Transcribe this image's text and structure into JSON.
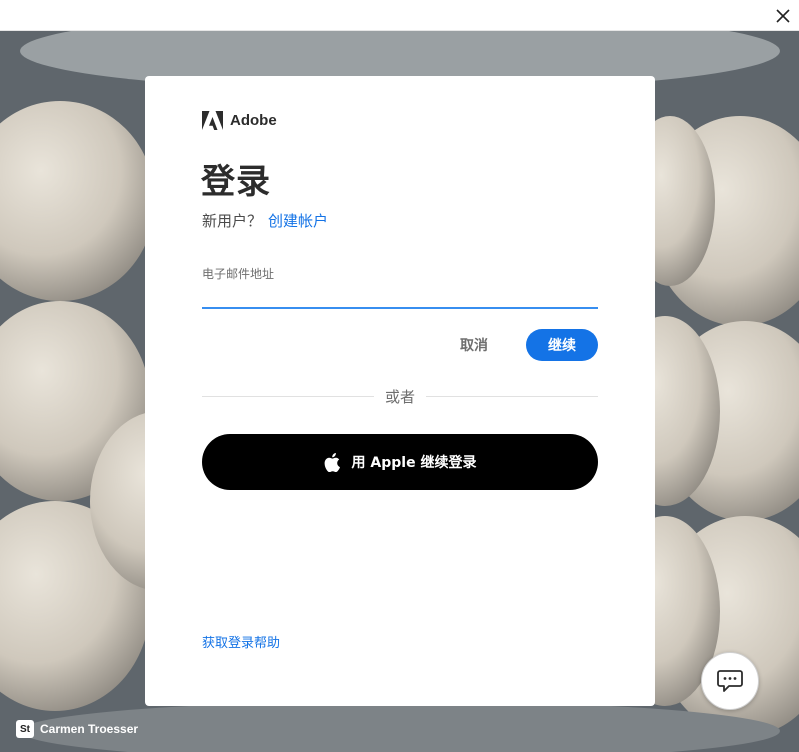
{
  "background": {
    "credit": {
      "logo_text": "St",
      "name": "Carmen Troesser"
    }
  },
  "card": {
    "brand": "Adobe",
    "title": "登录",
    "new_user_prompt": "新用户？",
    "create_account_link": "创建帐户",
    "email": {
      "label": "电子邮件地址",
      "value": "",
      "placeholder": ""
    },
    "cancel_label": "取消",
    "continue_label": "继续",
    "divider_text": "或者",
    "apple_label": "用 Apple 继续登录",
    "help_link": "获取登录帮助"
  },
  "colors": {
    "accent": "#1473e6",
    "apple_button": "#000000"
  }
}
